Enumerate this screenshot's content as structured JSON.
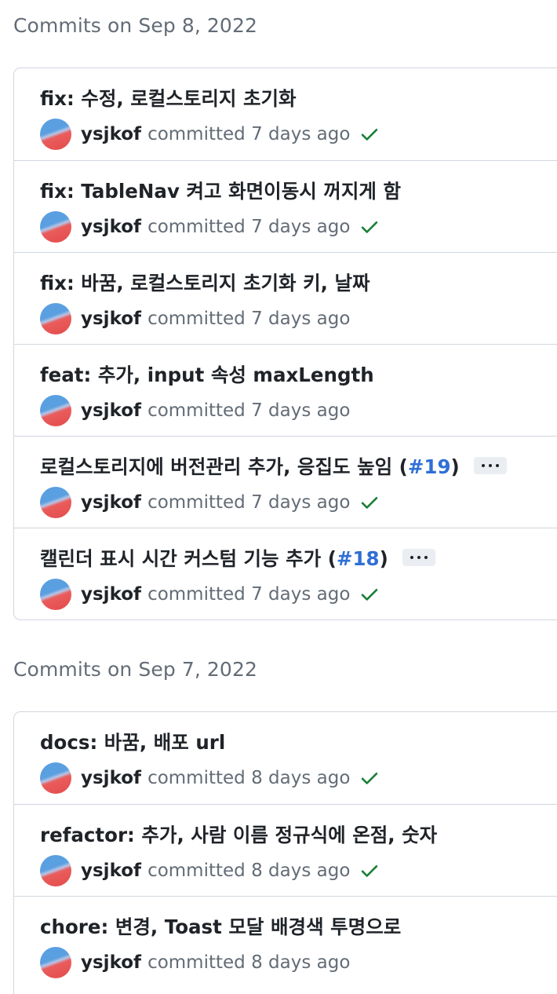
{
  "groups": [
    {
      "header": "Commits on Sep 8, 2022",
      "commits": [
        {
          "title": "fix: 수정, 로컬스토리지 초기화",
          "author": "ysjkof",
          "meta": "committed 7 days ago",
          "status": "success"
        },
        {
          "title": "fix: TableNav 켜고 화면이동시 꺼지게 함",
          "author": "ysjkof",
          "meta": "committed 7 days ago",
          "status": "success"
        },
        {
          "title": "fix: 바꿈, 로컬스토리지 초기화 키, 날짜",
          "author": "ysjkof",
          "meta": "committed 7 days ago",
          "status": "none"
        },
        {
          "title": "feat: 추가, input 속성 maxLength",
          "author": "ysjkof",
          "meta": "committed 7 days ago",
          "status": "none"
        },
        {
          "title": "로컬스토리지에 버전관리 추가, 응집도 높임 (",
          "pr": "#19",
          "title_end": ")",
          "author": "ysjkof",
          "meta": "committed 7 days ago",
          "status": "success",
          "expandable": true
        },
        {
          "title": "캘린더 표시 시간 커스텀 기능 추가 (",
          "pr": "#18",
          "title_end": ")",
          "author": "ysjkof",
          "meta": "committed 7 days ago",
          "status": "success",
          "expandable": true
        }
      ]
    },
    {
      "header": "Commits on Sep 7, 2022",
      "commits": [
        {
          "title": "docs: 바꿈, 배포 url",
          "author": "ysjkof",
          "meta": "committed 8 days ago",
          "status": "success"
        },
        {
          "title": "refactor: 추가, 사람 이름 정규식에 온점, 숫자",
          "author": "ysjkof",
          "meta": "committed 8 days ago",
          "status": "success"
        },
        {
          "title": "chore: 변경, Toast 모달 배경색 투명으로",
          "author": "ysjkof",
          "meta": "committed 8 days ago",
          "status": "none"
        }
      ]
    }
  ],
  "colors": {
    "success": "#1a7f37",
    "link": "#2f6fd6",
    "border": "#d0d7de",
    "muted": "#636c76"
  },
  "icons": {
    "status": "check-icon",
    "avatar": "avatar"
  }
}
